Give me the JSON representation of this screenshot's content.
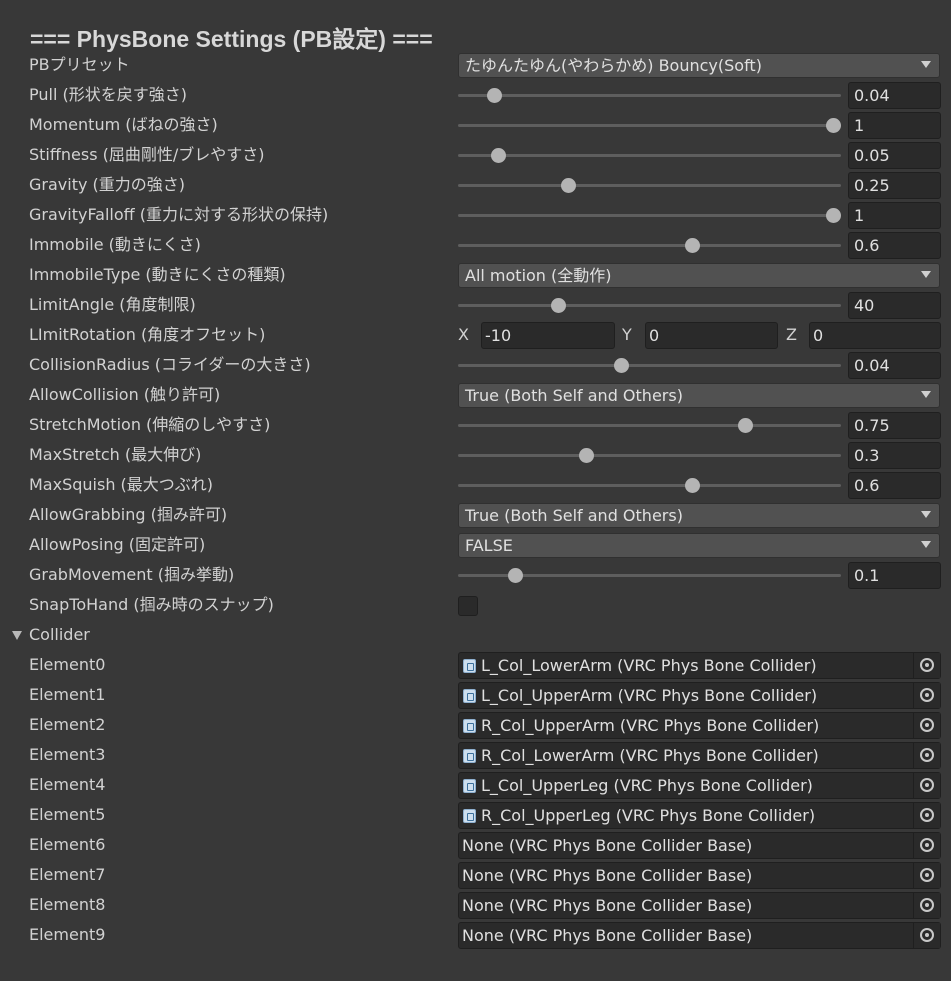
{
  "title": "=== PhysBone Settings (PB設定) ===",
  "rows": [
    {
      "label": "PBプリセット",
      "type": "dropdown",
      "value": "たゆんたゆん(やわらかめ) Bouncy(Soft)"
    },
    {
      "label": "Pull (形状を戻す強さ)",
      "type": "slider",
      "value": "0.04",
      "fraction": 0.04
    },
    {
      "label": "Momentum (ばねの強さ)",
      "type": "slider",
      "value": "1",
      "fraction": 1
    },
    {
      "label": "Stiffness (屈曲剛性/ブレやすさ)",
      "type": "slider",
      "value": "0.05",
      "fraction": 0.05
    },
    {
      "label": "Gravity (重力の強さ)",
      "type": "slider",
      "value": "0.25",
      "fraction": 0.25
    },
    {
      "label": "GravityFalloff (重力に対する形状の保持)",
      "type": "slider",
      "value": "1",
      "fraction": 1
    },
    {
      "label": "Immobile (動きにくさ)",
      "type": "slider",
      "value": "0.6",
      "fraction": 0.6
    },
    {
      "label": "ImmobileType (動きにくさの種類)",
      "type": "dropdown",
      "value": "All motion (全動作)"
    },
    {
      "label": "LimitAngle (角度制限)",
      "type": "slider",
      "value": "40",
      "fraction": 0.2222
    },
    {
      "label": "LImitRotation (角度オフセット)",
      "type": "vector3",
      "x_label": "X",
      "x": "-10",
      "y_label": "Y",
      "y": "0",
      "z_label": "Z",
      "z": "0"
    },
    {
      "label": "CollisionRadius (コライダーの大きさ)",
      "type": "slider",
      "value": "0.04",
      "fraction": 0.4
    },
    {
      "label": "AllowCollision (触り許可)",
      "type": "dropdown",
      "value": "True (Both Self and Others)"
    },
    {
      "label": "StretchMotion (伸縮のしやすさ)",
      "type": "slider",
      "value": "0.75",
      "fraction": 0.75
    },
    {
      "label": "MaxStretch (最大伸び)",
      "type": "slider",
      "value": "0.3",
      "fraction": 0.3
    },
    {
      "label": "MaxSquish (最大つぶれ)",
      "type": "slider",
      "value": "0.6",
      "fraction": 0.6
    },
    {
      "label": "AllowGrabbing (掴み許可)",
      "type": "dropdown",
      "value": "True (Both Self and Others)"
    },
    {
      "label": "AllowPosing (固定許可)",
      "type": "dropdown",
      "value": "FALSE"
    },
    {
      "label": "GrabMovement (掴み挙動)",
      "type": "slider",
      "value": "0.1",
      "fraction": 0.1
    },
    {
      "label": "SnapToHand (掴み時のスナップ)",
      "type": "checkbox",
      "checked": false
    },
    {
      "label": "Collider",
      "type": "foldout",
      "expanded": true
    },
    {
      "label": "Element0",
      "type": "object",
      "value": "L_Col_LowerArm (VRC Phys Bone Collider)",
      "has_icon": true
    },
    {
      "label": "Element1",
      "type": "object",
      "value": "L_Col_UpperArm (VRC Phys Bone Collider)",
      "has_icon": true
    },
    {
      "label": "Element2",
      "type": "object",
      "value": "R_Col_UpperArm (VRC Phys Bone Collider)",
      "has_icon": true
    },
    {
      "label": "Element3",
      "type": "object",
      "value": "R_Col_LowerArm (VRC Phys Bone Collider)",
      "has_icon": true
    },
    {
      "label": "Element4",
      "type": "object",
      "value": "L_Col_UpperLeg (VRC Phys Bone Collider)",
      "has_icon": true
    },
    {
      "label": "Element5",
      "type": "object",
      "value": "R_Col_UpperLeg (VRC Phys Bone Collider)",
      "has_icon": true
    },
    {
      "label": "Element6",
      "type": "object",
      "value": "None (VRC Phys Bone Collider Base)",
      "has_icon": false
    },
    {
      "label": "Element7",
      "type": "object",
      "value": "None (VRC Phys Bone Collider Base)",
      "has_icon": false
    },
    {
      "label": "Element8",
      "type": "object",
      "value": "None (VRC Phys Bone Collider Base)",
      "has_icon": false
    },
    {
      "label": "Element9",
      "type": "object",
      "value": "None (VRC Phys Bone Collider Base)",
      "has_icon": false
    }
  ],
  "icons": {
    "dropdown": "chevron-down-icon",
    "foldout": "foldout-triangle-icon",
    "object": "script-asset-icon",
    "picker": "object-picker-icon"
  }
}
